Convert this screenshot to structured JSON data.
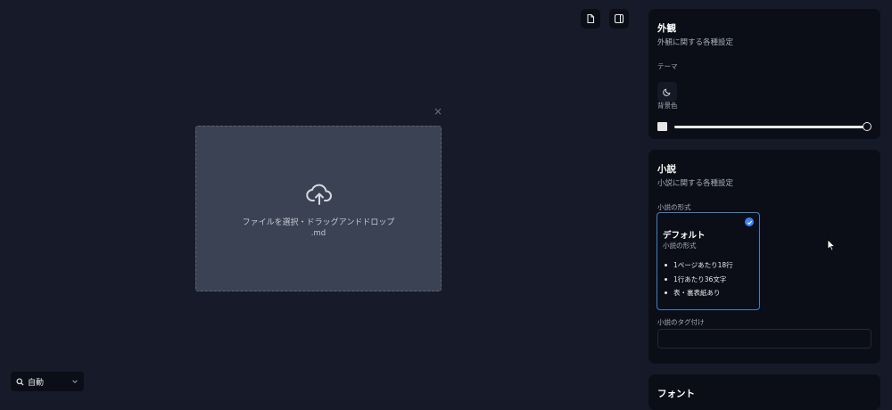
{
  "toolbar": {
    "document_icon": "document-icon",
    "sidebar_icon": "sidebar-toggle-icon"
  },
  "upload": {
    "close": "×",
    "label": "ファイルを選択・ドラッグアンドドロップ",
    "ext": ".md",
    "icon": "cloud-upload-icon"
  },
  "mode": {
    "label": "自動",
    "icon": "search-icon",
    "chevron": "chevron-down-icon"
  },
  "appearance": {
    "title": "外観",
    "subtitle": "外観に関する各種設定",
    "theme_label": "テーマ",
    "theme_icon": "moon-icon",
    "bg_label": "背景色",
    "bg_color": "#e6e6e6",
    "bg_slider_value": 1.0
  },
  "novel": {
    "title": "小説",
    "subtitle": "小説に関する各種設定",
    "format_label": "小説の形式",
    "format": {
      "title": "デフォルト",
      "subtitle": "小説の形式",
      "items": [
        "1ページあたり18行",
        "1行あたり36文字",
        "表・裏表紙あり"
      ],
      "selected": true
    },
    "tag_label": "小説のタグ付け",
    "tag_value": ""
  },
  "font": {
    "title": "フォント"
  },
  "colors": {
    "accent": "#3b82f6",
    "panel": "#0b0e17",
    "background": "#161a28"
  }
}
